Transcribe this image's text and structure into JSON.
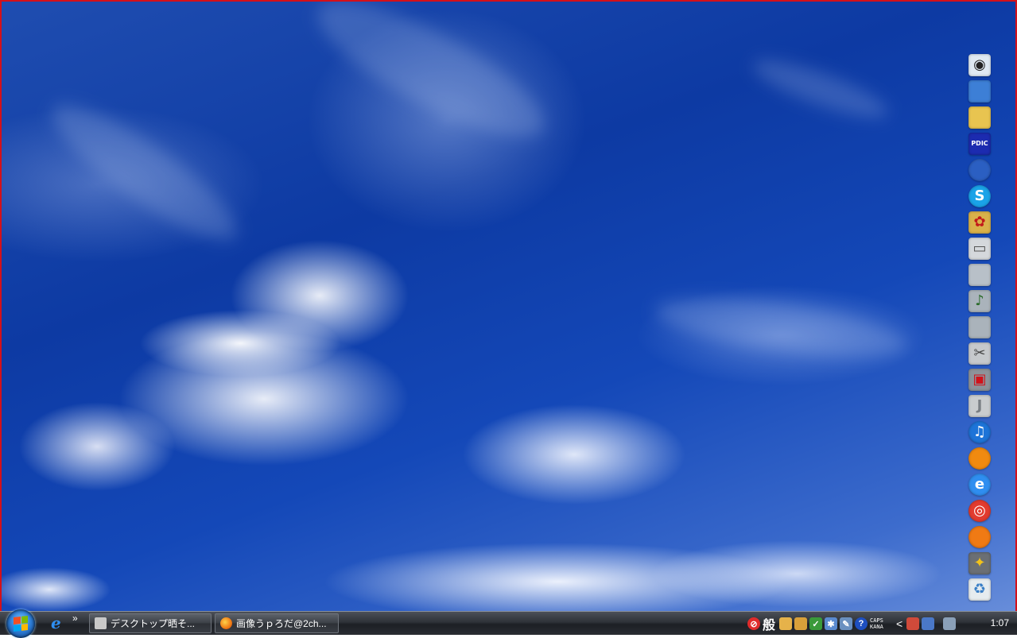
{
  "desktop": {
    "wallpaper": "blue sky with white clouds",
    "border_color": "#d4101a"
  },
  "dock": {
    "icons": [
      {
        "name": "camera-app-icon",
        "glyph": "◉",
        "bg": "#dfe9f2",
        "fg": "#222"
      },
      {
        "name": "monitor-app-icon",
        "glyph": "",
        "bg": "#3d7fd6",
        "fg": "#fff"
      },
      {
        "name": "folder-icon",
        "glyph": "",
        "bg": "#e8c450",
        "fg": "#fff"
      },
      {
        "name": "pdic-dictionary-icon",
        "glyph": "PDIC",
        "bg": "#1c2bb0",
        "fg": "#fff"
      },
      {
        "name": "google-earth-icon",
        "glyph": "",
        "bg": "#2b5fc2",
        "fg": "#fff"
      },
      {
        "name": "skype-icon",
        "glyph": "S",
        "bg": "#1aa3e8",
        "fg": "#fff"
      },
      {
        "name": "network-app-icon",
        "glyph": "✿",
        "bg": "#d9b14a",
        "fg": "#c21b1b"
      },
      {
        "name": "computer-icon",
        "glyph": "▭",
        "bg": "#d5d8dc",
        "fg": "#555"
      },
      {
        "name": "open-folder-icon",
        "glyph": "",
        "bg": "#b8c0c8",
        "fg": "#fff"
      },
      {
        "name": "music-folder-icon",
        "glyph": "♪",
        "bg": "#aab3bb",
        "fg": "#2a6b2a"
      },
      {
        "name": "pictures-folder-icon",
        "glyph": "",
        "bg": "#aab3bb",
        "fg": "#fff"
      },
      {
        "name": "tools-icon",
        "glyph": "✂",
        "bg": "#c6c9cc",
        "fg": "#444"
      },
      {
        "name": "tv-app-icon",
        "glyph": "▣",
        "bg": "#8d939a",
        "fg": "#d0121a"
      },
      {
        "name": "j-app-icon",
        "glyph": "J",
        "bg": "#c9ccce",
        "fg": "#7a7f84"
      },
      {
        "name": "itunes-icon",
        "glyph": "♫",
        "bg": "#1d74d8",
        "fg": "#fff"
      },
      {
        "name": "winamp-icon",
        "glyph": "",
        "bg": "#f08a10",
        "fg": "#fff"
      },
      {
        "name": "internet-explorer-icon",
        "glyph": "e",
        "bg": "#2f8ef0",
        "fg": "#fff"
      },
      {
        "name": "chrome-icon",
        "glyph": "◎",
        "bg": "#e23b2f",
        "fg": "#fff"
      },
      {
        "name": "firefox-icon",
        "glyph": "",
        "bg": "#f07a14",
        "fg": "#fff"
      },
      {
        "name": "wand-tool-icon",
        "glyph": "✦",
        "bg": "#6b6f74",
        "fg": "#f2c21a"
      },
      {
        "name": "recycle-bin-icon",
        "glyph": "♻",
        "bg": "#e6ecef",
        "fg": "#3a7fc6"
      }
    ]
  },
  "taskbar": {
    "quicklaunch_more": "»",
    "tasks": [
      {
        "label": "デスクトップ晒そ...",
        "icon_color": "#c9c9c9"
      },
      {
        "label": "画像うｐろだ@2ch...",
        "icon_color": "#f07a14"
      }
    ],
    "tray": {
      "general_label": "般",
      "caps_label": "CAPS",
      "kana_label": "KANA",
      "arrow": "<"
    },
    "clock": "1:07"
  }
}
